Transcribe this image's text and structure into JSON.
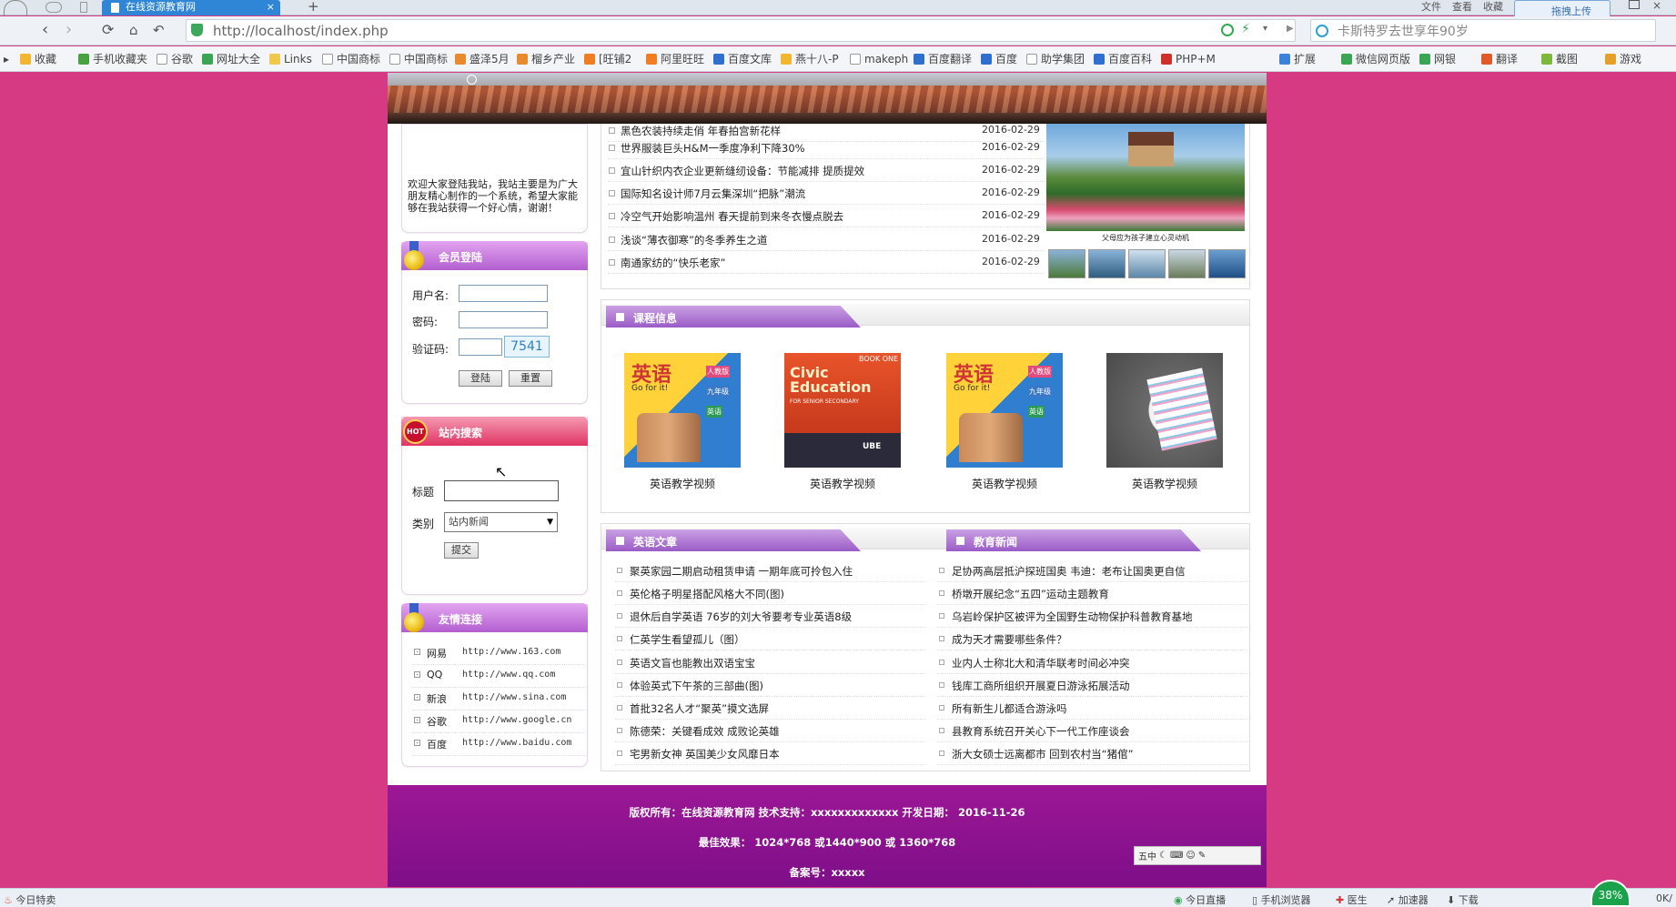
{
  "browser": {
    "tab_title": "在线资源教育网",
    "new_tab": "+",
    "tab_close": "×",
    "top_menu": [
      "文件",
      "查看",
      "收藏"
    ],
    "upload_label": "拖拽上传",
    "url": "http://localhost/index.php",
    "search_text": "卡斯特罗去世享年90岁",
    "bookmarks": [
      "收藏",
      "手机收藏夹",
      "谷歌",
      "网址大全",
      "Links",
      "中国商标",
      "中国商标",
      "盛泽5月",
      "榴乡产业",
      "[旺铺2",
      "阿里旺旺",
      "百度文库",
      "燕十八-P",
      "makeph",
      "百度翻译",
      "百度",
      "助学集团",
      "百度百科",
      "PHP+M"
    ],
    "ext_items": [
      "扩展",
      "微信网页版",
      "网银",
      "翻译",
      "截图",
      "游戏"
    ]
  },
  "sidebar": {
    "welcome": "欢迎大家登陆我站，我站主要是为广大朋友精心制作的一个系统，希望大家能够在我站获得一个好心情，谢谢！",
    "login": {
      "title": "会员登陆",
      "username_label": "用户名:",
      "password_label": "密码:",
      "captcha_label": "验证码:",
      "captcha_code": "7541",
      "login_btn": "登陆",
      "reset_btn": "重置"
    },
    "search": {
      "badge": "HOT",
      "title": "站内搜索",
      "title_label": "标题",
      "type_label": "类别",
      "type_selected": "站内新闻",
      "submit_btn": "提交"
    },
    "links": {
      "title": "友情连接",
      "items": [
        {
          "name": "网易",
          "url": "http://www.163.com"
        },
        {
          "name": "QQ",
          "url": "http://www.qq.com"
        },
        {
          "name": "新浪",
          "url": "http://www.sina.com"
        },
        {
          "name": "谷歌",
          "url": "http://www.google.cn"
        },
        {
          "name": "百度",
          "url": "http://www.baidu.com"
        }
      ]
    }
  },
  "news": {
    "items": [
      {
        "title": "黑色农装持续走俏 年春拍宫新花样",
        "date": "2016-02-29"
      },
      {
        "title": "世界服装巨头H&M一季度净利下降30%",
        "date": "2016-02-29"
      },
      {
        "title": "宜山针织内衣企业更新缝纫设备：节能减排 提质提效",
        "date": "2016-02-29"
      },
      {
        "title": "国际知名设计师7月云集深圳“把脉”潮流",
        "date": "2016-02-29"
      },
      {
        "title": "冷空气开始影响温州 春天提前到来冬衣慢点脱去",
        "date": "2016-02-29"
      },
      {
        "title": "浅谈“薄衣御寒”的冬季养生之道",
        "date": "2016-02-29"
      },
      {
        "title": "南通家纺的“快乐老家”",
        "date": "2016-02-29"
      }
    ],
    "photo_caption": "父母应为孩子建立心灵动机"
  },
  "courses": {
    "title": "课程信息",
    "items": [
      {
        "caption": "英语教学视频",
        "cover_title": "英语",
        "cover_sub": "Go for it!",
        "cover_badges": [
          "人教版",
          "九年级",
          "英语"
        ]
      },
      {
        "caption": "英语教学视频",
        "cover_title": "Civic Education",
        "cover_sub": "FOR SENIOR SECONDARY",
        "cover_badges": [
          "BOOK ONE",
          "UBE"
        ]
      },
      {
        "caption": "英语教学视频",
        "cover_title": "英语",
        "cover_sub": "Go for it!",
        "cover_badges": [
          "人教版",
          "九年级",
          "英语"
        ]
      },
      {
        "caption": "英语教学视频",
        "cover_title": "",
        "cover_sub": "",
        "cover_badges": []
      }
    ]
  },
  "english_articles": {
    "title": "英语文章",
    "items": [
      "聚英家园二期启动租赁申请 一期年底可拎包入住",
      "英伦格子明星搭配风格大不同(图)",
      "退休后自学英语 76岁的刘大爷要考专业英语8级",
      "仁英学生看望孤儿（图）",
      "英语文盲也能教出双语宝宝",
      "体验英式下午茶的三部曲(图)",
      "首批32名人才“聚英”摸文选屏",
      "陈德荣：关键看成效 成败论英雄",
      "宅男新女神 英国美少女风靡日本"
    ]
  },
  "edu_news": {
    "title": "教育新闻",
    "items": [
      "足协两高层抵沪探班国奥 韦迪：老布让国奥更自信",
      "桥墩开展纪念“五四”运动主题教育",
      "乌岩岭保护区被评为全国野生动物保护科普教育基地",
      "成为天才需要哪些条件？",
      "业内人士称北大和清华联考时间必冲突",
      "钱库工商所组织开展夏日游泳拓展活动",
      "所有新生儿都适合游泳吗",
      "县教育系统召开关心下一代工作座谈会",
      "浙大女硕士远离都市 回到农村当“猪倌”"
    ]
  },
  "footer": {
    "line1": "版权所有：在线资源教育网  技术支持：xxxxxxxxxxxxx  开发日期： 2016-11-26",
    "line2": "最佳效果： 1024*768  或1440*900  或  1360*768",
    "line3": "备案号：xxxxx",
    "ime": "五中"
  },
  "statusbar": {
    "left": "今日特卖",
    "items": [
      "今日直播",
      "手机浏览器",
      "医生",
      "加速器",
      "下载"
    ],
    "percent": "38%",
    "right": "0K/"
  },
  "colors": {
    "page_bg": "#d63a83",
    "accent_purple": "#9a5cc6",
    "footer": "#8a1290",
    "tab_active": "#2f86d6"
  }
}
